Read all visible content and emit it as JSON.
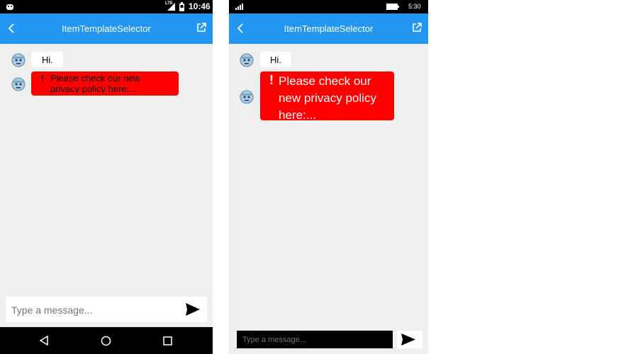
{
  "android": {
    "status": {
      "time": "10:46",
      "network": "LTE"
    },
    "title": "ItemTemplateSelector",
    "messages": [
      {
        "text": "Hi."
      },
      {
        "alert_mark": "!",
        "text": "Please check our new privacy policy here:..."
      }
    ],
    "input": {
      "placeholder": "Type a message..."
    }
  },
  "windows": {
    "status": {
      "time": "5:30"
    },
    "title": "ItemTemplateSelector",
    "messages": [
      {
        "text": "Hi."
      },
      {
        "alert_mark": "!",
        "text": "Please check our new privacy policy here:..."
      }
    ],
    "input": {
      "placeholder": "Type a message..."
    }
  },
  "colors": {
    "titlebar": "#2196f3",
    "alert_bubble": "#ff0000",
    "background": "#efeff0"
  }
}
